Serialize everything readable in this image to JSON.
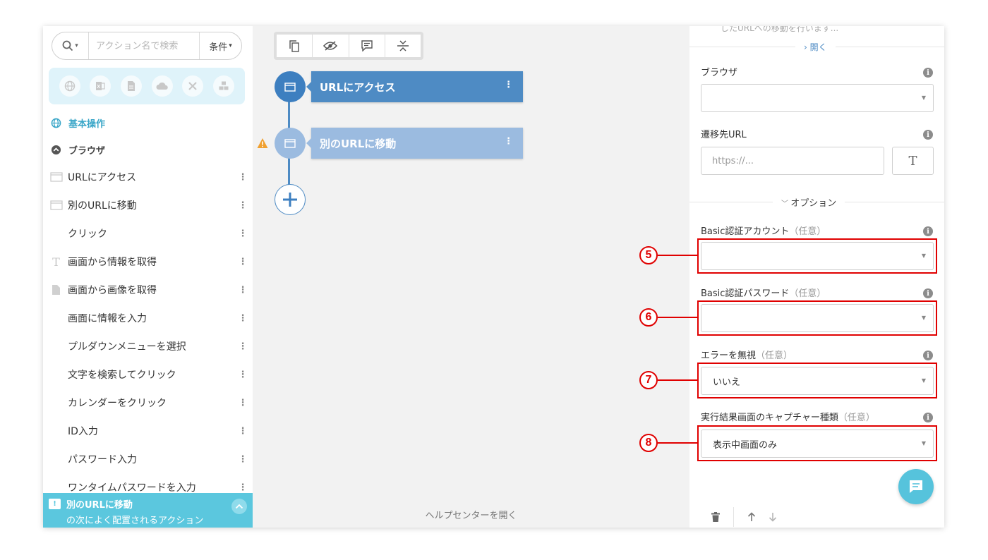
{
  "sidebar": {
    "search": {
      "placeholder": "アクション名で検索",
      "condition_label": "条件"
    },
    "categories": [
      "globe-icon",
      "excel-icon",
      "document-icon",
      "cloud-icon",
      "tools-icon",
      "cubes-icon"
    ],
    "section_basic": "基本操作",
    "section_browser": "ブラウザ",
    "actions": [
      {
        "label": "URLにアクセス",
        "icon": "browser-window-icon"
      },
      {
        "label": "別のURLに移動",
        "icon": "browser-window-icon"
      },
      {
        "label": "クリック",
        "icon": ""
      },
      {
        "label": "画面から情報を取得",
        "icon": "text-t-icon"
      },
      {
        "label": "画面から画像を取得",
        "icon": "file-icon"
      },
      {
        "label": "画面に情報を入力",
        "icon": ""
      },
      {
        "label": "プルダウンメニューを選択",
        "icon": ""
      },
      {
        "label": "文字を検索してクリック",
        "icon": ""
      },
      {
        "label": "カレンダーをクリック",
        "icon": ""
      },
      {
        "label": "ID入力",
        "icon": ""
      },
      {
        "label": "パスワード入力",
        "icon": ""
      },
      {
        "label": "ワンタイムパスワードを入力",
        "icon": ""
      }
    ],
    "next_bar": {
      "title": "別のURLに移動",
      "subtitle": "の次によく配置されるアクション"
    }
  },
  "canvas": {
    "toolbar": [
      "copy-icon",
      "eye-off-icon",
      "comment-icon",
      "collapse-icon"
    ],
    "nodes": [
      {
        "label": "URLにアクセス",
        "state": "active"
      },
      {
        "label": "別のURLに移動",
        "state": "selected-warning"
      }
    ],
    "help_link": "ヘルプセンターを開く"
  },
  "panel": {
    "truncated_text": "したURLへの移動を行います...",
    "open_link": "開く",
    "browser_label": "ブラウザ",
    "browser_value": "",
    "url_label": "遷移先URL",
    "url_placeholder": "https://...",
    "url_value": "",
    "t_button": "T",
    "options_label": "オプション",
    "fields": [
      {
        "label": "Basic認証アカウント",
        "optional": "（任意）",
        "value": "",
        "anno": "5"
      },
      {
        "label": "Basic認証パスワード",
        "optional": "（任意）",
        "value": "",
        "anno": "6"
      },
      {
        "label": "エラーを無視",
        "optional": "（任意）",
        "value": "いいえ",
        "anno": "7"
      },
      {
        "label": "実行結果画面のキャプチャー種類",
        "optional": "（任意）",
        "value": "表示中画面のみ",
        "anno": "8"
      }
    ]
  },
  "colors": {
    "primary": "#4e8bc4",
    "primary_light": "#9bbbe0",
    "accent": "#5bc7de",
    "annotation": "#e00000",
    "warning": "#f0a030"
  }
}
